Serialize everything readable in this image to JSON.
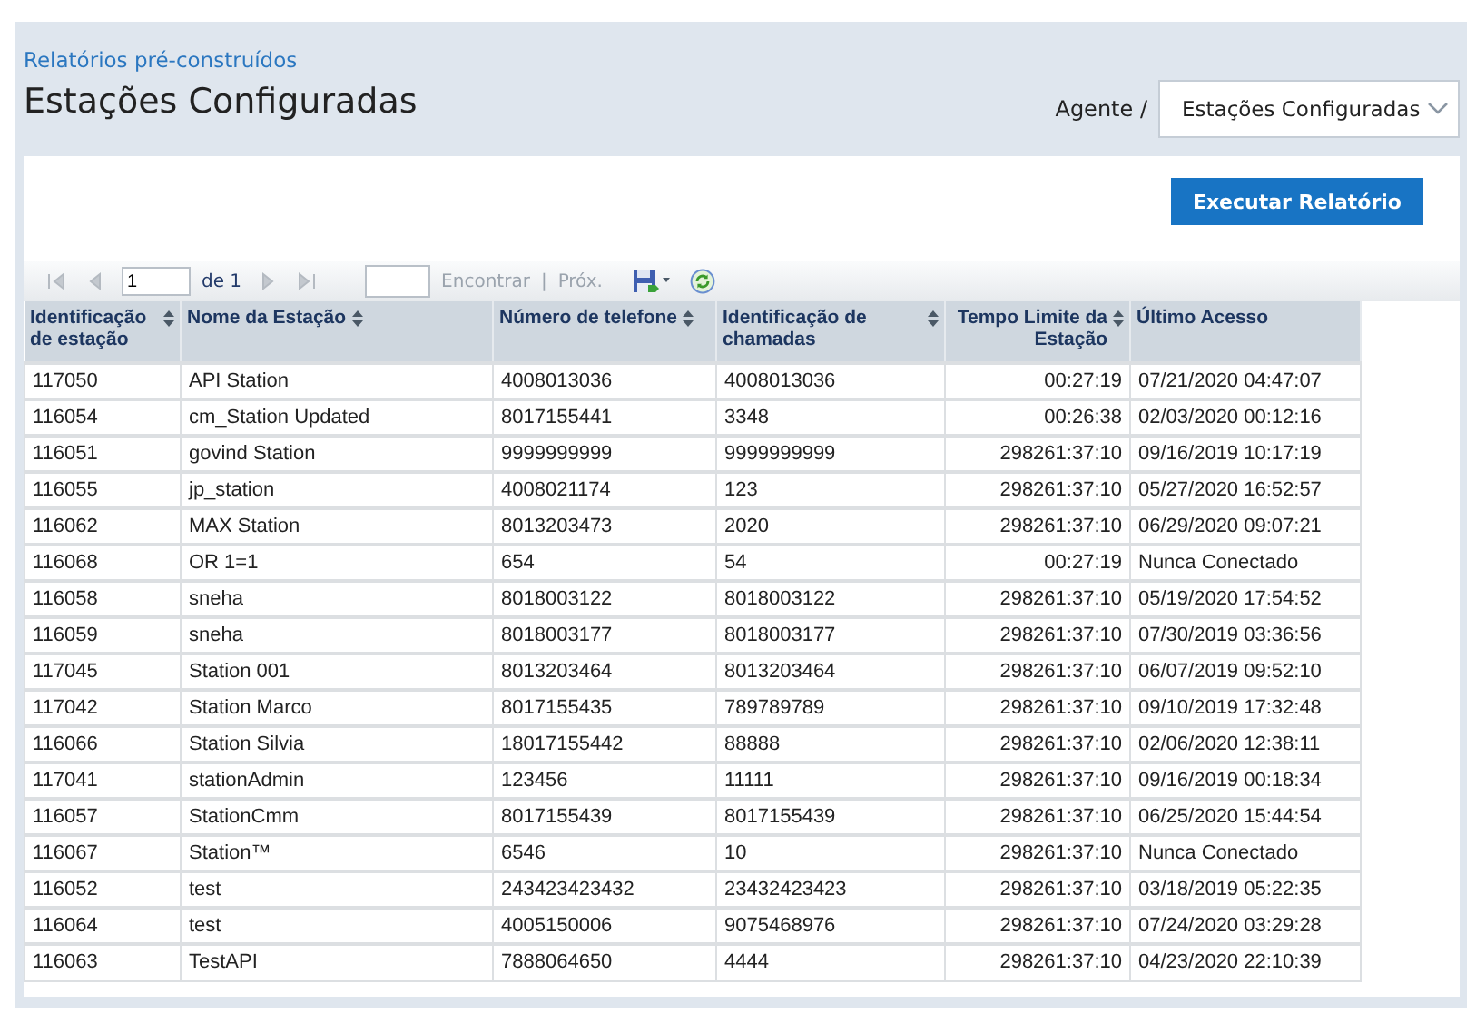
{
  "breadcrumb": "Relatórios pré-construídos",
  "title": "Estações Configuradas",
  "agent_label": "Agente /",
  "agent_dropdown": {
    "value": "Estações Configuradas"
  },
  "run_button": "Executar Relatório",
  "toolbar": {
    "nav": [
      {
        "kind": "first",
        "disabled": true
      },
      {
        "kind": "prev",
        "disabled": true
      }
    ],
    "page_value": "1",
    "page_count": "de 1",
    "nav_after": [
      {
        "kind": "next",
        "disabled": true
      },
      {
        "kind": "last",
        "disabled": true
      }
    ],
    "find_link": {
      "label": "Encontrar",
      "disabled": true
    },
    "separator": "|",
    "next_link": {
      "label": "Próx.",
      "disabled": true
    }
  },
  "table": {
    "columns": [
      {
        "label": "Identificação de estação",
        "sortable": true
      },
      {
        "label": "Nome da Estação",
        "sortable": true
      },
      {
        "label": "Número de telefone",
        "sortable": true
      },
      {
        "label": "Identificação de chamadas",
        "sortable": true
      },
      {
        "label": "Tempo Limite da Estação",
        "sortable": true
      },
      {
        "label": "Último Acesso",
        "sortable": false
      }
    ],
    "rows": [
      [
        "117050",
        "API Station",
        "4008013036",
        "4008013036",
        "00:27:19",
        "07/21/2020 04:47:07"
      ],
      [
        "116054",
        "cm_Station Updated",
        "8017155441",
        "3348",
        "00:26:38",
        "02/03/2020 00:12:16"
      ],
      [
        "116051",
        "govind Station",
        "9999999999",
        "9999999999",
        "298261:37:10",
        "09/16/2019 10:17:19"
      ],
      [
        "116055",
        "jp_station",
        "4008021174",
        "123",
        "298261:37:10",
        "05/27/2020 16:52:57"
      ],
      [
        "116062",
        "MAX Station",
        "8013203473",
        "2020",
        "298261:37:10",
        "06/29/2020 09:07:21"
      ],
      [
        "116068",
        "OR 1=1",
        "654",
        "54",
        "00:27:19",
        "Nunca Conectado"
      ],
      [
        "116058",
        "sneha",
        "8018003122",
        "8018003122",
        "298261:37:10",
        "05/19/2020 17:54:52"
      ],
      [
        "116059",
        "sneha",
        "8018003177",
        "8018003177",
        "298261:37:10",
        "07/30/2019 03:36:56"
      ],
      [
        "117045",
        "Station 001",
        "8013203464",
        "8013203464",
        "298261:37:10",
        "06/07/2019 09:52:10"
      ],
      [
        "117042",
        "Station Marco",
        "8017155435",
        "789789789",
        "298261:37:10",
        "09/10/2019 17:32:48"
      ],
      [
        "116066",
        "Station Silvia",
        "18017155442",
        "88888",
        "298261:37:10",
        "02/06/2020 12:38:11"
      ],
      [
        "117041",
        "stationAdmin",
        "123456",
        "11111",
        "298261:37:10",
        "09/16/2019 00:18:34"
      ],
      [
        "116057",
        "StationCmm",
        "8017155439",
        "8017155439",
        "298261:37:10",
        "06/25/2020 15:44:54"
      ],
      [
        "116067",
        "Station™",
        "6546",
        "10",
        "298261:37:10",
        "Nunca Conectado"
      ],
      [
        "116052",
        "test",
        "243423423432",
        "23432423423",
        "298261:37:10",
        "03/18/2019 05:22:35"
      ],
      [
        "116064",
        "test",
        "4005150006",
        "9075468976",
        "298261:37:10",
        "07/24/2020 03:29:28"
      ],
      [
        "116063",
        "TestAPI",
        "7888064650",
        "4444",
        "298261:37:10",
        "04/23/2020 22:10:39"
      ]
    ]
  }
}
